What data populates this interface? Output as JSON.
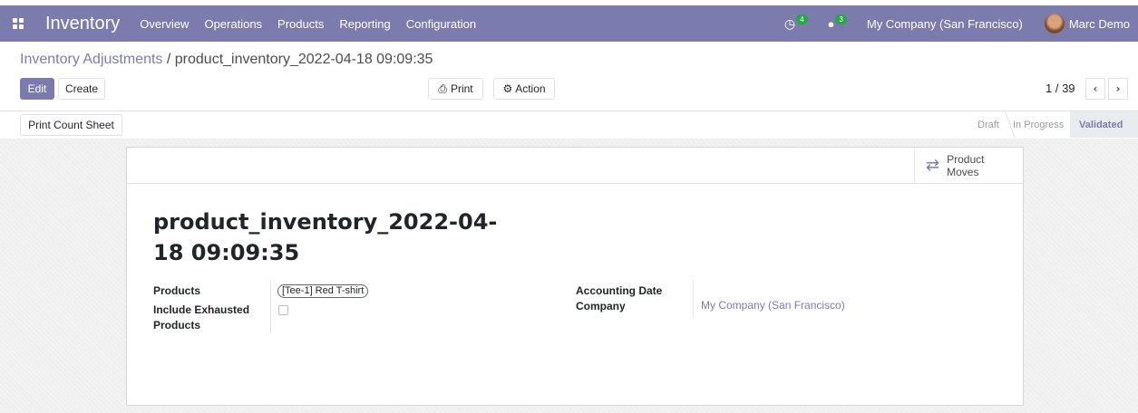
{
  "navbar": {
    "app_title": "Inventory",
    "menu": [
      "Overview",
      "Operations",
      "Products",
      "Reporting",
      "Configuration"
    ],
    "activity_count": "4",
    "message_count": "3",
    "company": "My Company (San Francisco)",
    "user": "Marc Demo",
    "icons": {
      "apps": "apps-grid-icon",
      "activity": "clock-icon",
      "messages": "chat-icon"
    },
    "color": "#7c7bad"
  },
  "breadcrumb": {
    "parent": "Inventory Adjustments",
    "separator": "/",
    "current": "product_inventory_2022-04-18 09:09:35"
  },
  "toolbar": {
    "edit": "Edit",
    "create": "Create",
    "print": "Print",
    "action": "Action"
  },
  "pager": {
    "value": "1 / 39"
  },
  "statusbar": {
    "print_count_sheet": "Print Count Sheet",
    "stages": [
      "Draft",
      "In Progress",
      "Validated"
    ],
    "active_stage": "Validated"
  },
  "smart_button": {
    "line1": "Product",
    "line2": "Moves"
  },
  "form": {
    "title_line1": "product_inventory_2022-04-",
    "title_line2": "18 09:09:35",
    "products_label": "Products",
    "product_tag": "[Tee-1] Red T-shirt",
    "include_exhausted_label_1": "Include Exhausted",
    "include_exhausted_label_2": "Products",
    "include_exhausted_checked": false,
    "accounting_date_label": "Accounting Date",
    "company_label": "Company",
    "company_value": "My Company (San Francisco)"
  }
}
